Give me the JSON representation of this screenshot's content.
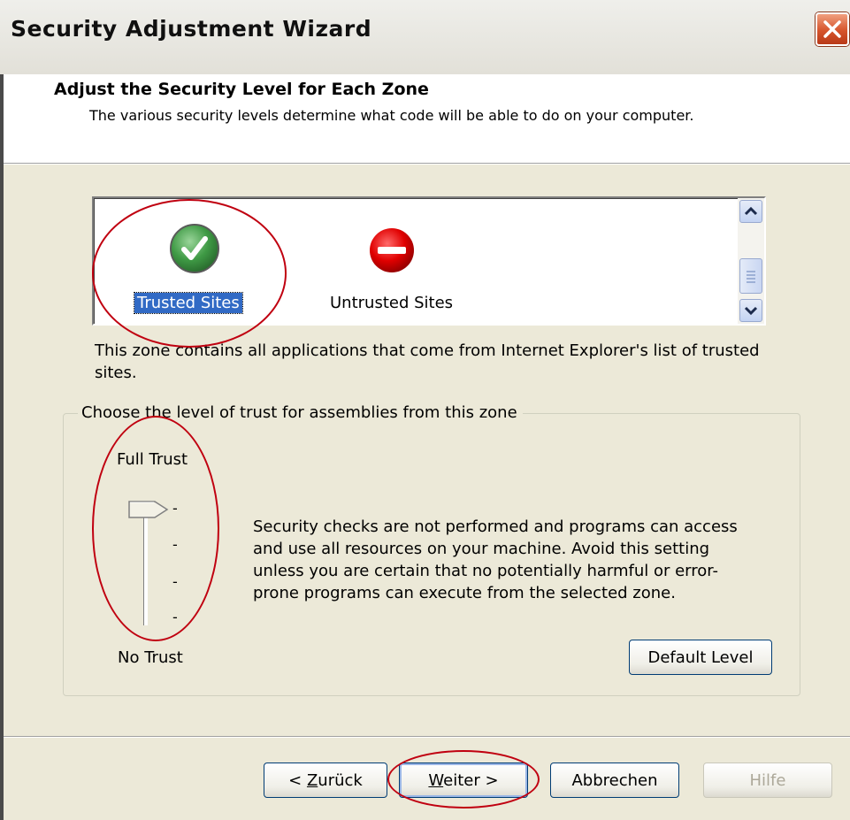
{
  "window": {
    "title": "Security Adjustment Wizard",
    "close_icon": "close-x-icon"
  },
  "header": {
    "title": "Adjust the Security Level for Each Zone",
    "subtitle": "The various security levels determine what code will be able to do on your computer."
  },
  "zones": {
    "items": [
      {
        "label": "Trusted Sites",
        "icon": "green-checkmark-icon",
        "selected": true
      },
      {
        "label": "Untrusted Sites",
        "icon": "red-no-entry-icon",
        "selected": false
      }
    ],
    "description": "This zone contains all applications that come from Internet Explorer's list of trusted sites."
  },
  "trust_group": {
    "legend": "Choose the level of trust for assemblies from this zone",
    "top_label": "Full Trust",
    "bottom_label": "No Trust",
    "level": "Full Trust",
    "level_description": "Security checks are not performed and programs can access and use all resources on your machine.  Avoid this setting unless you are certain that no potentially harmful or error-prone programs can execute from the selected zone.",
    "default_button": "Default Level"
  },
  "buttons": {
    "back": {
      "prefix": "< ",
      "accel": "Z",
      "rest": "urück"
    },
    "next": {
      "accel": "W",
      "rest": "eiter >"
    },
    "cancel": "Abbrechen",
    "help": "Hilfe"
  },
  "colors": {
    "annotation": "#c00010",
    "selection": "#316ac5",
    "dialog_bg": "#ece9d8"
  }
}
